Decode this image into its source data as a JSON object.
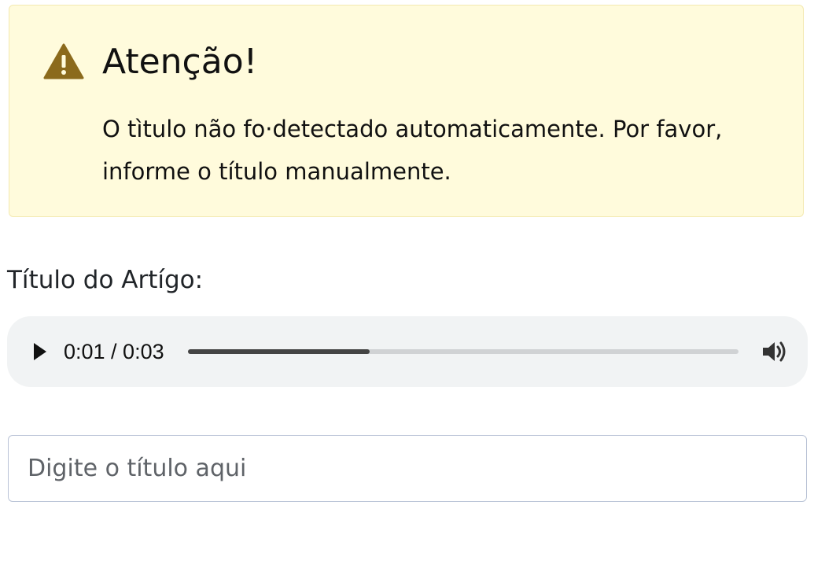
{
  "alert": {
    "icon": "warning-triangle-icon",
    "title": "Atenção!",
    "message": "O tìtulo não fo·detectado automaticamente. Por favor, informe o título manualmente.",
    "background_color": "#fffbdc",
    "icon_color": "#8b6a1c"
  },
  "form": {
    "label": "Título do Artígo:",
    "audio": {
      "play_icon": "play-icon",
      "volume_icon": "volume-icon",
      "current_time": "0:01",
      "duration": "0:03",
      "time_text": "0:01 / 0:03",
      "progress": 0.33
    },
    "title_input": {
      "value": "",
      "placeholder": "Digite o título aqui"
    }
  }
}
